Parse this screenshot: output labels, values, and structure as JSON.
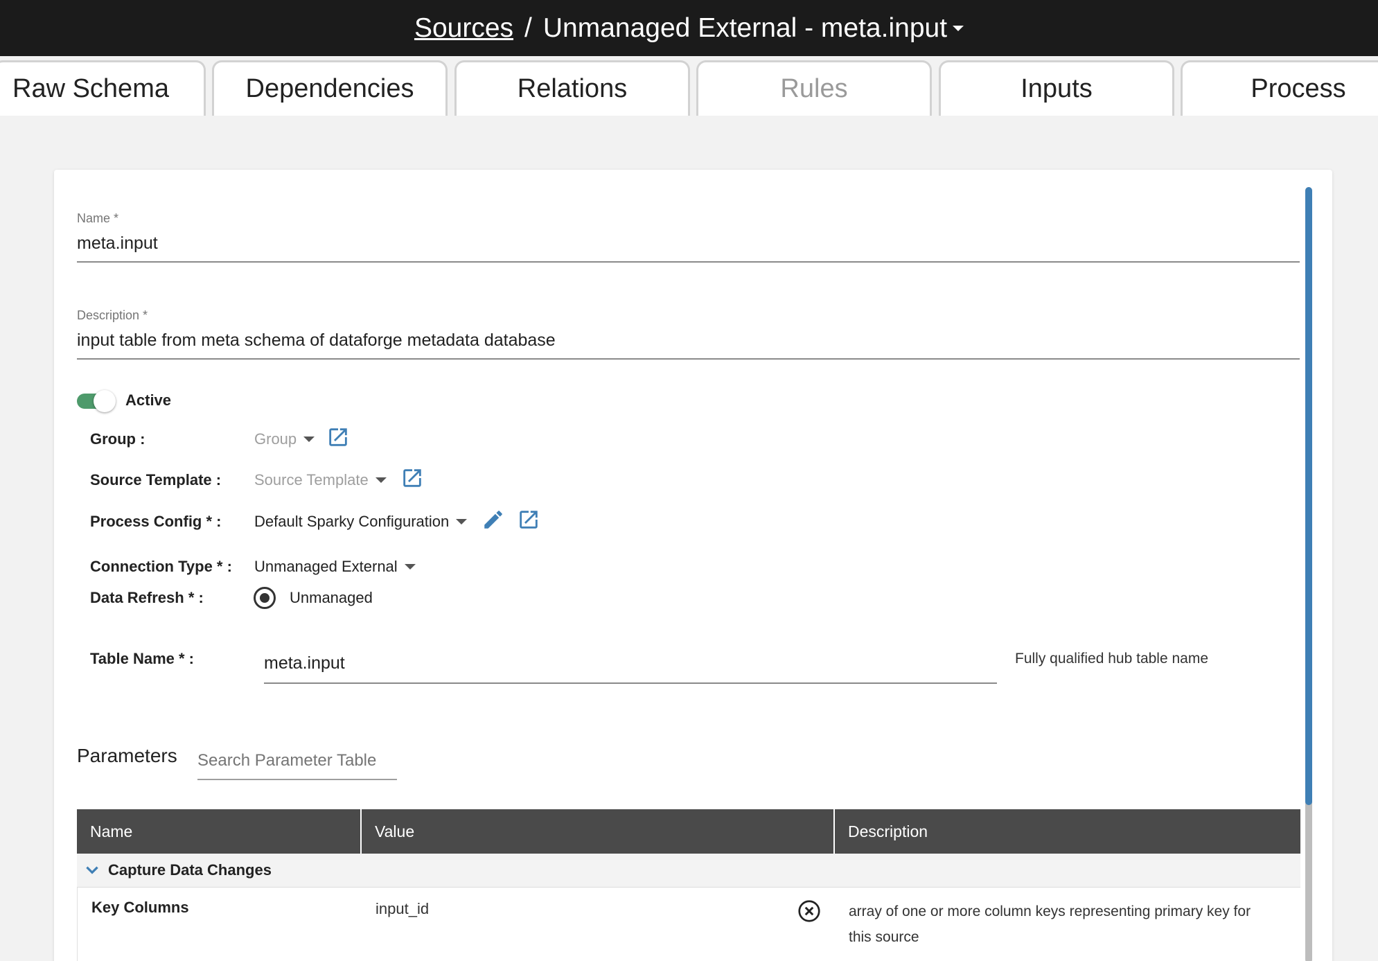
{
  "header": {
    "crumb_link": "Sources",
    "separator": "/",
    "title": "Unmanaged External - meta.input"
  },
  "tabs": [
    {
      "label": "Raw Schema",
      "disabled": false
    },
    {
      "label": "Dependencies",
      "disabled": false
    },
    {
      "label": "Relations",
      "disabled": false
    },
    {
      "label": "Rules",
      "disabled": true
    },
    {
      "label": "Inputs",
      "disabled": false
    },
    {
      "label": "Process",
      "disabled": false
    }
  ],
  "form": {
    "name_label": "Name *",
    "name_value": "meta.input",
    "description_label": "Description *",
    "description_value": "input table from meta schema of dataforge metadata database",
    "active_label": "Active",
    "active_on": true,
    "group_label": "Group :",
    "group_value": "Group",
    "source_template_label": "Source Template :",
    "source_template_value": "Source Template",
    "process_config_label": "Process Config * :",
    "process_config_value": "Default Sparky Configuration",
    "connection_type_label": "Connection Type * :",
    "connection_type_value": "Unmanaged External",
    "data_refresh_label": "Data Refresh * :",
    "data_refresh_value": "Unmanaged",
    "table_name_label": "Table Name * :",
    "table_name_value": "meta.input",
    "table_name_hint": "Fully qualified hub table name"
  },
  "parameters": {
    "title": "Parameters",
    "search_placeholder": "Search Parameter Table",
    "columns": [
      "Name",
      "Value",
      "Description"
    ],
    "group": "Capture Data Changes",
    "rows": [
      {
        "name": "Key Columns",
        "value": "input_id",
        "description_line1": "array of one or more column keys representing primary key for",
        "description_line2": "this source"
      }
    ]
  },
  "colors": {
    "header_bg": "#1b1b1b",
    "accent_blue": "#3f7fb5",
    "toggle_green": "#4e9a6b",
    "table_header_bg": "#4a4a4a"
  },
  "icons": {
    "open_external": "open-in-new-icon",
    "edit": "pencil-icon",
    "clear": "circle-x-icon",
    "expand": "chevron-down-icon"
  }
}
